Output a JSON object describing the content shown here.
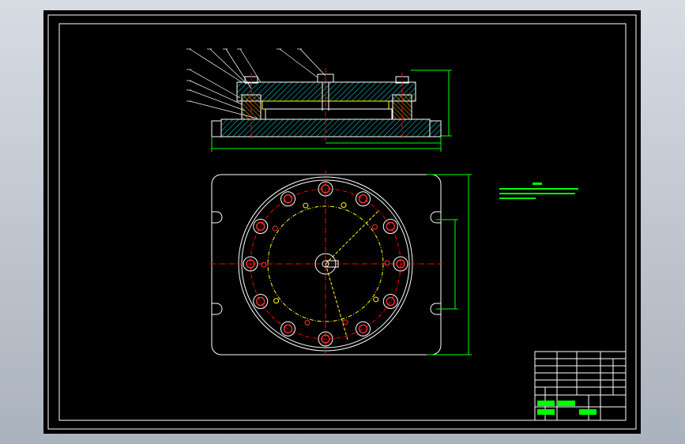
{
  "colors": {
    "background": "#000000",
    "outline": "#ffffff",
    "dimension": "#00ff00",
    "centerline": "#ff0000",
    "hatch": "#00c8c8",
    "bolt_pcd": "#ffff00",
    "fastener": "#ff00ff",
    "label_leader": "#ffffff"
  },
  "drawing": {
    "section_view": {
      "item_labels": [
        "",
        "",
        "",
        "",
        "",
        "",
        "",
        "",
        "",
        ""
      ]
    },
    "plan_view": {
      "holes_outer_ring": 12,
      "holes_inner_ring": 10
    },
    "technical_notes": {
      "title": "",
      "lines": [
        "",
        "",
        ""
      ]
    },
    "title_block": {
      "cells": []
    }
  }
}
